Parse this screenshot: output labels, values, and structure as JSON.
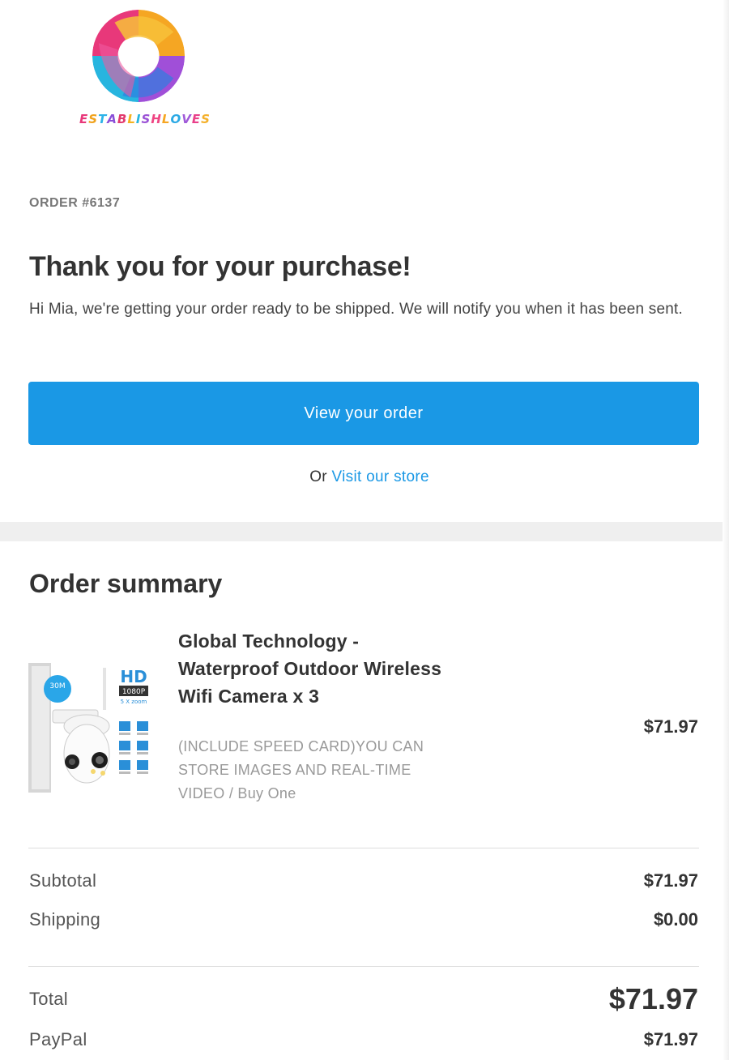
{
  "brand": {
    "name": "ESTABLISHLOVES",
    "wordmark_colors": [
      "#e8387a",
      "#f0a21c",
      "#2cb3e8",
      "#8a4fd8",
      "#e23a6e",
      "#f5b21f",
      "#27b5df",
      "#9b52d6",
      "#ef4583",
      "#f6a623",
      "#2ba9e4",
      "#a05ad9",
      "#e9408a",
      "#f4b02a"
    ]
  },
  "order": {
    "number_label": "ORDER #6137"
  },
  "message": {
    "headline": "Thank you for your purchase!",
    "intro": "Hi Mia, we're getting your order ready to be shipped. We will notify you when it has been sent."
  },
  "actions": {
    "view_order_label": "View your order",
    "or_text": "Or",
    "visit_store_label": "Visit our store"
  },
  "summary": {
    "title": "Order summary",
    "item": {
      "title": "Global Technology - Waterproof Outdoor Wireless Wifi Camera x 3",
      "variant": "(INCLUDE SPEED CARD)YOU CAN STORE IMAGES AND REAL-TIME VIDEO / Buy One",
      "price": "$71.97",
      "thumbnail_text": {
        "resolution_badge": "HD",
        "resolution": "1080P",
        "zoom": "5 X zoom",
        "range": "30M"
      }
    },
    "subtotal_label": "Subtotal",
    "subtotal_value": "$71.97",
    "shipping_label": "Shipping",
    "shipping_value": "$0.00",
    "total_label": "Total",
    "total_value": "$71.97",
    "payment_label": "PayPal",
    "payment_value": "$71.97"
  },
  "colors": {
    "accent": "#1a98e5",
    "band": "#efefef",
    "text": "#333333",
    "muted": "#999999"
  }
}
